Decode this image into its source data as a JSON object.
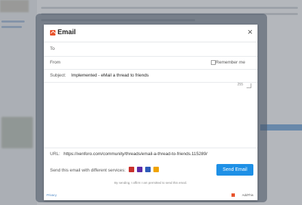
{
  "dialog": {
    "title": "Email",
    "close_glyph": "×",
    "fields": {
      "to_label": "To",
      "from_label": "From",
      "remember_label": "Remember me",
      "subject_label": "Subject:",
      "subject_value": "Implemented - eMail a thread to friends",
      "message_count": "255",
      "url_label": "URL:",
      "url_value": "https://xenforo.com/community/threads/email-a-thread-to-friends.115289/"
    },
    "services": {
      "label": "Send this email with different services:",
      "icons": [
        {
          "name": "gmail-icon",
          "color": "#c9302c"
        },
        {
          "name": "yahoo-icon",
          "color": "#5d2ca8"
        },
        {
          "name": "outlook-icon",
          "color": "#2d5bb9"
        },
        {
          "name": "other-mail-icon",
          "color": "#f0a300"
        }
      ]
    },
    "send_button": "Send Email",
    "note": "By sending, I affirm I am permitted to send this email.",
    "footer_left": "Privacy",
    "footer_right": "AddThis"
  },
  "colors": {
    "accent": "#1e90e6",
    "brand": "#e8542d"
  }
}
